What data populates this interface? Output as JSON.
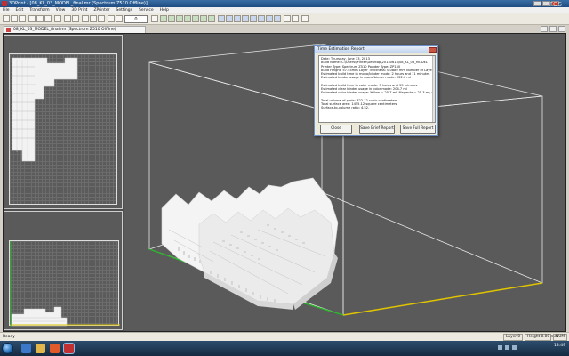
{
  "window": {
    "title": "3DPrint - [08_KL_03_MODEL_final.mr (Spectrum Z510 Offline)]",
    "logo_text": "FOS"
  },
  "menu": [
    "File",
    "Edit",
    "Transform",
    "View",
    "3D Print",
    "ZPrinter",
    "Settings",
    "Service",
    "Help"
  ],
  "toolbar": {
    "layer_value": "0"
  },
  "document": {
    "tab_title": "08_KL_03_MODEL_final.mr (Spectrum Z510 Offline)"
  },
  "dialog": {
    "title": "Time Estimation Report",
    "lines": [
      "Date: Thursday, June 13, 2013",
      "Build Name: C:\\Users\\Printer\\Desktop\\20130613\\08_KL_03_MODEL",
      "Printer Type: Spectrum Z510      Powder Type: ZP130",
      "Build Height: 57.45mm    Layer Thickness: 0.0889 mm    Number of Layers",
      "Estimated build time in mono/binder mode: 2 hours and 11 minutes",
      "Estimated binder usage in mono/binder mode: 222.0 ml",
      "",
      "Estimated build time in color mode: 3 hours and 55 minutes",
      "Estimated clear binder usage in color mode: 204.7 ml",
      "Estimated color binder usage: Yellow =    25.7 ml; Magenta =    25.3 ml; Cy",
      "",
      "Total volume of parts: 322.12 cubic centimeters.",
      "Total surface area: 1455.12 square centimeters.",
      "Surface-to-volume ratio: 4.52."
    ],
    "buttons": {
      "close": "Close",
      "save_brief": "Save Brief Report",
      "save_full": "Save Full Report"
    }
  },
  "statusbar": {
    "ready": "Ready",
    "layer": "Layer 0",
    "height": "Height 0.00 mm",
    "num": "NUM"
  },
  "taskbar": {
    "time": "13:49"
  },
  "colors": {
    "viewport_bg": "#5a5a5a",
    "build_box": "#e6e6e6",
    "model": "#f2f2f2",
    "axis_green": "#2bb52b",
    "axis_yellow": "#e0c400"
  }
}
